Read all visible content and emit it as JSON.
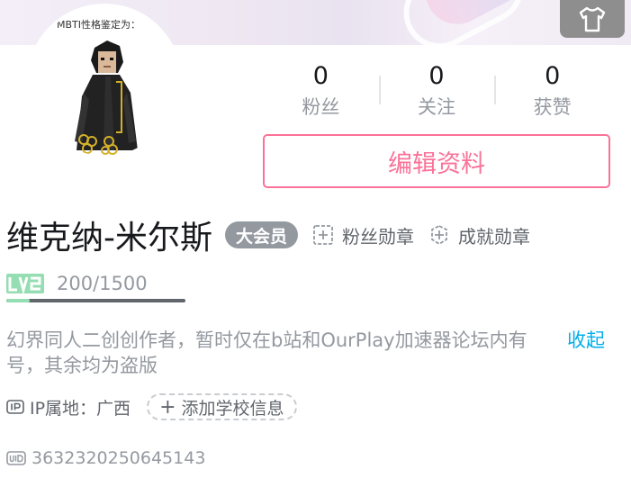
{
  "avatar": {
    "caption": "MBTI性格鉴定为："
  },
  "stats": [
    {
      "value": "0",
      "label": "粉丝"
    },
    {
      "value": "0",
      "label": "关注"
    },
    {
      "value": "0",
      "label": "获赞"
    }
  ],
  "edit_button_label": "编辑资料",
  "profile": {
    "name": "维克纳-米尔斯",
    "vip_label": "大会员",
    "fan_medal_label": "粉丝勋章",
    "achievement_medal_label": "成就勋章",
    "level": "LV2",
    "exp_text": "200/1500",
    "exp_progress": 0.133,
    "bio": "幻界同人二创创作者，暂时仅在b站和OurPlay加速器论坛内有号，其余均为盗版",
    "collapse_label": "收起",
    "ip_text": "IP属地：广西",
    "add_school_label": "添加学校信息",
    "uid": "3632320250645143"
  },
  "colors": {
    "accent_pink": "#fb7299",
    "link_blue": "#00aeec",
    "level_green": "#95ddb2",
    "vip_gray": "#9499a0"
  },
  "icons": {
    "dress": "tshirt-icon",
    "fan_medal": "medal-add-icon",
    "achievement": "achievement-add-icon",
    "ip": "ip-icon",
    "uid": "uid-icon"
  }
}
